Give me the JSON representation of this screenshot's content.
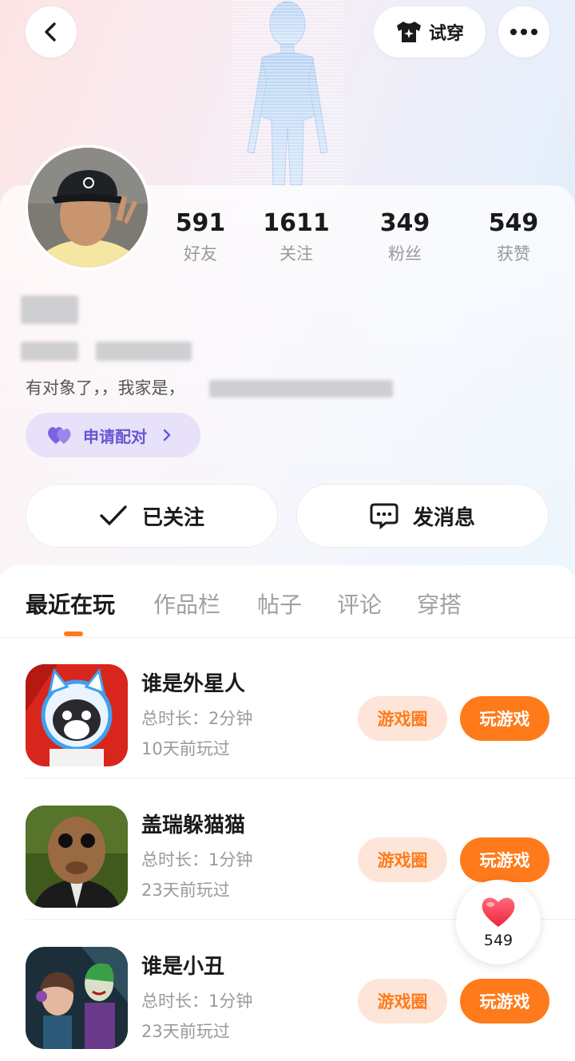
{
  "header": {
    "tryon_label": "试穿"
  },
  "profile": {
    "stats": [
      {
        "value": "591",
        "label": "好友"
      },
      {
        "value": "1611",
        "label": "关注"
      },
      {
        "value": "349",
        "label": "粉丝"
      },
      {
        "value": "549",
        "label": "获赞"
      }
    ],
    "bio": "有对象了，，我家是，",
    "match_label": "申请配对"
  },
  "actions": {
    "following_label": "已关注",
    "message_label": "发消息"
  },
  "tabs": [
    "最近在玩",
    "作品栏",
    "帖子",
    "评论",
    "穿搭"
  ],
  "games": [
    {
      "title": "谁是外星人",
      "duration": "总时长：2分钟",
      "last_played": "10天前玩过",
      "circle_label": "游戏圈",
      "play_label": "玩游戏"
    },
    {
      "title": "盖瑞躲猫猫",
      "duration": "总时长：1分钟",
      "last_played": "23天前玩过",
      "circle_label": "游戏圈",
      "play_label": "玩游戏"
    },
    {
      "title": "谁是小丑",
      "duration": "总时长：1分钟",
      "last_played": "23天前玩过",
      "circle_label": "游戏圈",
      "play_label": "玩游戏"
    }
  ],
  "like_float": {
    "count": "549"
  },
  "colors": {
    "accent": "#ff7a1a",
    "match": "#6a55d6"
  }
}
